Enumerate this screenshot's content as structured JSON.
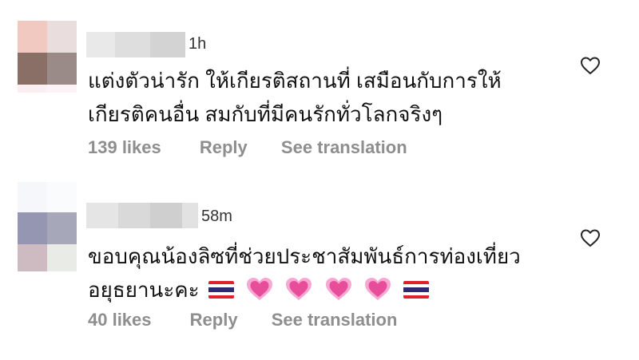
{
  "comments": [
    {
      "time": "1h",
      "text_lines": [
        "แต่งตัวน่ารัก ให้เกียรติสถานที่ เสมือนกับการให้",
        "เกียรติคนอื่น  สมกับที่มีคนรักทั่วโลกจริงๆ"
      ],
      "likes": "139 likes",
      "reply": "Reply",
      "translate": "See translation"
    },
    {
      "time": "58m",
      "text_lines": [
        "ขอบคุณน้องลิซที่ช่วยประชาสัมพันธ์การท่องเที่ยว",
        "อยุธยานะคะ"
      ],
      "likes": "40 likes",
      "reply": "Reply",
      "translate": "See translation"
    }
  ],
  "icons": {
    "like": "heart-outline-icon",
    "emoji_heart": "growing-heart-emoji",
    "emoji_flag": "thailand-flag-emoji"
  },
  "colors": {
    "meta_gray": "#8e8e8e",
    "heart_pink": "#e84d9a",
    "flag_red": "#e0212d",
    "flag_blue": "#2d2a6e"
  }
}
